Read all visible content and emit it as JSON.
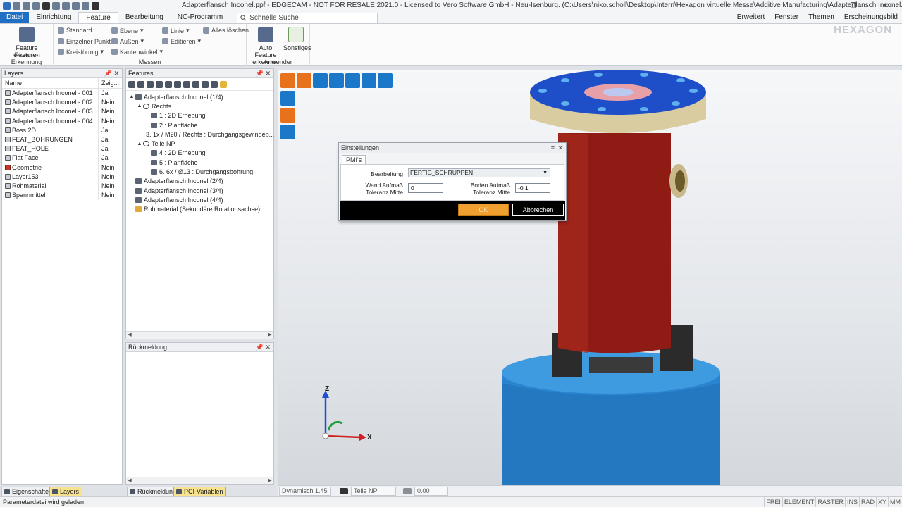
{
  "window": {
    "title": "Adapterflansch Inconel.ppf - EDGECAM - NOT FOR RESALE 2021.0 - Licensed to Vero Software GmbH - Neu-Isenburg. (C:\\Users\\niko.scholl\\Desktop\\Intern\\Hexagon virtuelle Messe\\Additive Manufacturing\\Adapterflansch Inconel.ppf)",
    "minimize": "–",
    "restore": "❐",
    "close": "✕"
  },
  "menu": {
    "tabs": [
      "Datei",
      "Einrichtung",
      "Feature",
      "Bearbeitung",
      "NC-Programm"
    ],
    "active": "Feature",
    "search_placeholder": "Schnelle Suche",
    "right_items": [
      "Erweitert",
      "Fenster",
      "Themen",
      "Erscheinungsbild"
    ],
    "brand": "HEXAGON"
  },
  "ribbon": {
    "feature_erkennung": {
      "button": "Feature erkennen",
      "label": "Feature-Erkennung"
    },
    "messen": {
      "col1": [
        "Standard",
        "Einzelner Punkt",
        "Kreisförmig"
      ],
      "col2": [
        "Ebene",
        "Außen",
        "Kantenwinkel"
      ],
      "col3": [
        "Linie",
        "Editieren"
      ],
      "col4": [
        "Alles löschen"
      ],
      "label": "Messen"
    },
    "anwender": {
      "auto_feature": "Auto Feature erkennen",
      "sonstiges": "Sonstiges",
      "label": "Anwender"
    }
  },
  "layers": {
    "title": "Layers",
    "columns": [
      "Name",
      "Zeig..."
    ],
    "rows": [
      {
        "name": "Adapterflansch Inconel - 001",
        "show": "Ja",
        "icon": "part-icon"
      },
      {
        "name": "Adapterflansch Inconel - 002",
        "show": "Nein",
        "icon": "part-icon"
      },
      {
        "name": "Adapterflansch Inconel - 003",
        "show": "Nein",
        "icon": "part-icon"
      },
      {
        "name": "Adapterflansch Inconel - 004",
        "show": "Nein",
        "icon": "part-icon"
      },
      {
        "name": "Boss 2D",
        "show": "Ja",
        "icon": "part-icon"
      },
      {
        "name": "FEAT_BOHRUNGEN",
        "show": "Ja",
        "icon": "part-icon"
      },
      {
        "name": "FEAT_HOLE",
        "show": "Ja",
        "icon": "part-icon"
      },
      {
        "name": "Flat Face",
        "show": "Ja",
        "icon": "part-icon"
      },
      {
        "name": "Geometrie",
        "show": "Nein",
        "icon": "geometry-icon"
      },
      {
        "name": "Layer153",
        "show": "Nein",
        "icon": "part-icon"
      },
      {
        "name": "Rohmaterial",
        "show": "Nein",
        "icon": "part-icon"
      },
      {
        "name": "Spannmittel",
        "show": "Nein",
        "icon": "part-icon"
      }
    ]
  },
  "features": {
    "title": "Features",
    "tree": [
      {
        "label": "Adapterflansch Inconel (1/4)",
        "level": 0,
        "toggle": "▲",
        "icon": "part"
      },
      {
        "label": "Rechts",
        "level": 1,
        "toggle": "▲",
        "icon": "circ"
      },
      {
        "label": "1 :  2D Erhebung",
        "level": 2,
        "toggle": "",
        "icon": "feat"
      },
      {
        "label": "2 :  Planfläche",
        "level": 2,
        "toggle": "",
        "icon": "feat"
      },
      {
        "label": "3. 1x / M20 / Rechts :  Durchgangsgewindeb...",
        "level": 2,
        "toggle": "",
        "icon": "feat"
      },
      {
        "label": "Teile NP",
        "level": 1,
        "toggle": "▲",
        "icon": "circ"
      },
      {
        "label": "4 :  2D Erhebung",
        "level": 2,
        "toggle": "",
        "icon": "feat"
      },
      {
        "label": "5 :  Planfläche",
        "level": 2,
        "toggle": "",
        "icon": "feat"
      },
      {
        "label": "6. 6x / Ø13 :  Durchgangsbohrung",
        "level": 2,
        "toggle": "",
        "icon": "feat"
      },
      {
        "label": "Adapterflansch Inconel (2/4)",
        "level": 0,
        "toggle": "",
        "icon": "part"
      },
      {
        "label": "Adapterflansch Inconel (3/4)",
        "level": 0,
        "toggle": "",
        "icon": "part"
      },
      {
        "label": "Adapterflansch Inconel (4/4)",
        "level": 0,
        "toggle": "",
        "icon": "part"
      },
      {
        "label": "Rohmaterial (Sekundäre Rotationsachse)",
        "level": 0,
        "toggle": "",
        "icon": "mat"
      }
    ]
  },
  "rueckmeldung": {
    "title": "Rückmeldung"
  },
  "bottom_tabs": {
    "eigenschaften": "Eigenschaften",
    "layers": "Layers",
    "rueckmeldung": "Rückmeldung",
    "pci": "PCI-Variablen"
  },
  "dialog": {
    "title": "Einstellungen",
    "tab": "PMI's",
    "bearbeitung_label": "Bearbeitung",
    "bearbeitung_value": "FERTIG_SCHRUPPEN",
    "wand_label": "Wand Aufmaß Toleranz Mitte",
    "wand_value": "0",
    "boden_label": "Boden Aufmaß Toleranz Mitte",
    "boden_value": "-0,1",
    "ok": "OK",
    "cancel": "Abbrechen"
  },
  "viewport": {
    "axis_z": "Z",
    "axis_x": "X"
  },
  "vp_status": {
    "dynamic": "Dynamisch 1.45",
    "view": "Teile NP",
    "value": "0.00"
  },
  "status": {
    "message": "Parameterdatei wird geladen",
    "flags": [
      "FREI",
      "ELEMENT",
      "RASTER",
      "INS",
      "RAD",
      "XY",
      "MM"
    ]
  },
  "colors": {
    "accent_blue": "#1f6fc5",
    "ok_orange": "#f0a030",
    "part_red": "#8e1c14",
    "flange_blue": "#1f4fc8",
    "fixture_blue": "#2a84cf"
  }
}
